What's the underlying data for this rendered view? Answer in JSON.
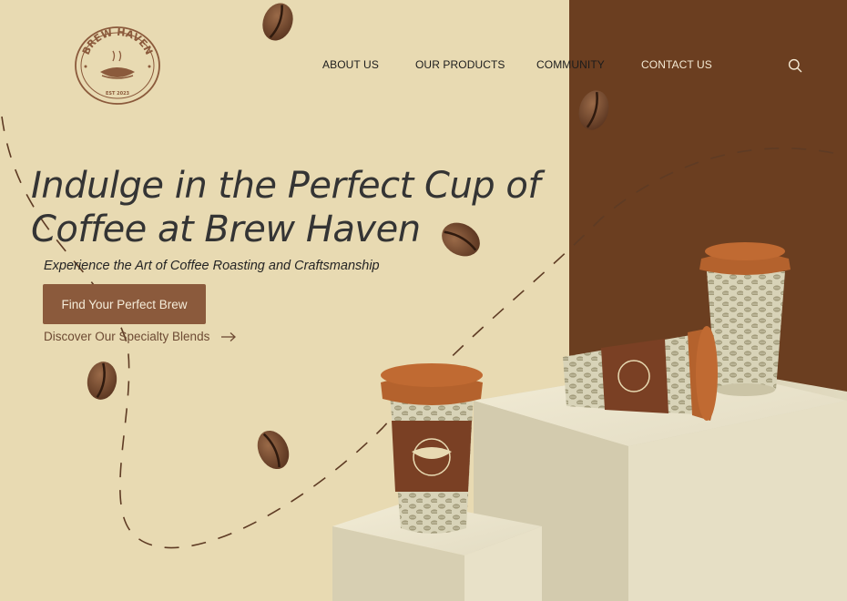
{
  "brand": {
    "logo_name": "BREW HAVEN",
    "logo_est": "EST 2023"
  },
  "nav": {
    "items": [
      {
        "label": "ABOUT US"
      },
      {
        "label": "OUR PRODUCTS"
      },
      {
        "label": "COMMUNITY"
      },
      {
        "label": "CONTACT US"
      }
    ],
    "search_icon": "search-icon"
  },
  "hero": {
    "title_line1": "Indulge in the Perfect Cup of",
    "title_line2": "Coffee at Brew Haven",
    "subtitle": "Experience the Art of Coffee Roasting and Craftsmanship",
    "cta_label": "Find Your Perfect Brew",
    "secondary_link": "Discover Our Specialty Blends"
  },
  "colors": {
    "background": "#e8dab2",
    "panel": "#6b3e20",
    "accent": "#8b5a3c",
    "cup_lid": "#b4622d",
    "pedestal": "#dcd4b8"
  }
}
